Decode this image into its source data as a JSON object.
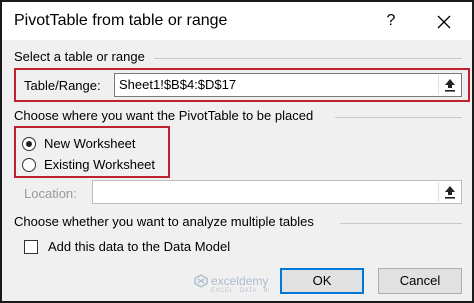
{
  "dialog": {
    "title": "PivotTable from table or range",
    "help_label": "?"
  },
  "select_section": {
    "heading": "Select a table or range",
    "range_label": "Table/Range:",
    "range_value": "Sheet1!$B$4:$D$17"
  },
  "placement_section": {
    "heading": "Choose where you want the PivotTable to be placed",
    "options": [
      {
        "label": "New Worksheet",
        "checked": true
      },
      {
        "label": "Existing Worksheet",
        "checked": false
      }
    ],
    "location_label": "Location:",
    "location_value": ""
  },
  "multiple_section": {
    "heading": "Choose whether you want to analyze multiple tables",
    "data_model_label": "Add this data to the Data Model",
    "data_model_checked": false
  },
  "buttons": {
    "ok": "OK",
    "cancel": "Cancel"
  },
  "watermark": {
    "brand": "exceldemy",
    "tagline": "EXCEL · DATA · BI"
  },
  "colors": {
    "highlight": "#c0222d",
    "default_button_border": "#0078d7",
    "dialog_bg": "#f0f0f0"
  }
}
